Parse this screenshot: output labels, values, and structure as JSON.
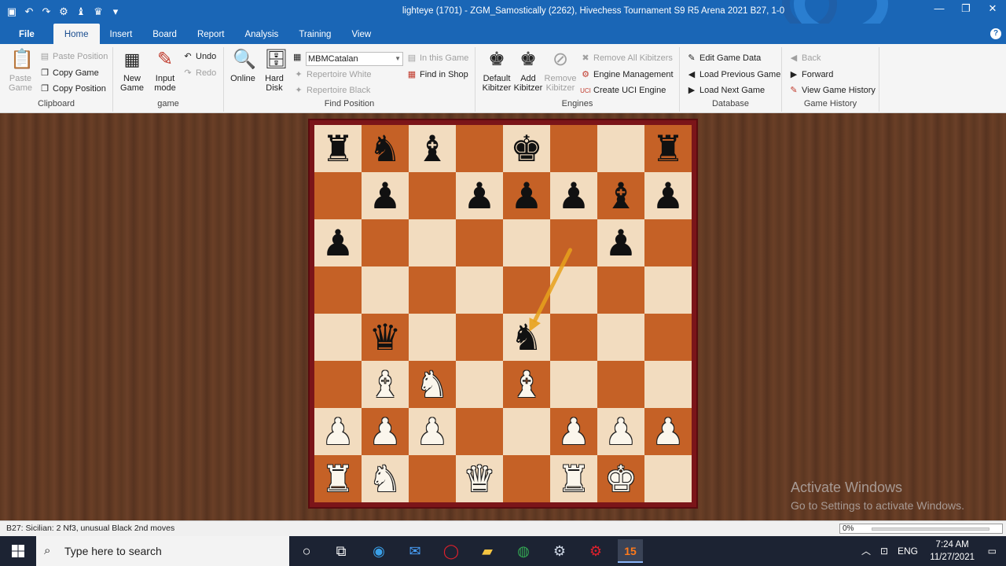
{
  "window": {
    "title": "lighteye (1701) - ZGM_Samostically (2262), Hivechess Tournament S9 R5 Arena 2021  B27, 1-0"
  },
  "tabs": [
    "File",
    "Home",
    "Insert",
    "Board",
    "Report",
    "Analysis",
    "Training",
    "View"
  ],
  "active_tab": "Home",
  "ribbon": {
    "clipboard": {
      "label": "Clipboard",
      "paste_game": "Paste Game",
      "paste_position": "Paste Position",
      "copy_game": "Copy Game",
      "copy_position": "Copy Position"
    },
    "game": {
      "label": "game",
      "new_game": "New Game",
      "input_mode": "Input mode",
      "undo": "Undo",
      "redo": "Redo"
    },
    "find_position": {
      "label": "Find Position",
      "online": "Online",
      "hard_disk": "Hard Disk",
      "database_value": "MBMCatalan",
      "in_this_game": "In this Game",
      "find_in_shop": "Find in Shop",
      "repertoire_white": "Repertoire White",
      "repertoire_black": "Repertoire Black"
    },
    "engines": {
      "label": "Engines",
      "default_kibitzer": "Default Kibitzer",
      "add_kibitzer": "Add Kibitzer",
      "remove_kibitzer": "Remove Kibitzer",
      "remove_all_kibitzers": "Remove All Kibitzers",
      "engine_management": "Engine Management",
      "create_uci_engine": "Create UCI Engine"
    },
    "database": {
      "label": "Database",
      "edit_game_data": "Edit Game Data",
      "load_previous_game": "Load Previous Game",
      "load_next_game": "Load Next Game"
    },
    "game_history": {
      "label": "Game History",
      "back": "Back",
      "forward": "Forward",
      "view_game_history": "View Game History"
    }
  },
  "board": {
    "orientation": "white-bottom",
    "ranks": [
      [
        "r",
        "n",
        "b",
        "",
        "k",
        "",
        "",
        "r"
      ],
      [
        "",
        "p",
        "",
        "p",
        "p",
        "p",
        "b",
        "p"
      ],
      [
        "p",
        "",
        "",
        "",
        "",
        "",
        "p",
        ""
      ],
      [
        "",
        "",
        "",
        "",
        "",
        "",
        "",
        ""
      ],
      [
        "",
        "q",
        "",
        "",
        "n",
        "",
        "",
        ""
      ],
      [
        "",
        "B",
        "N",
        "",
        "B",
        "",
        "",
        ""
      ],
      [
        "P",
        "P",
        "P",
        "",
        "",
        "P",
        "P",
        "P"
      ],
      [
        "R",
        "N",
        "",
        "Q",
        "",
        "R",
        "K",
        ""
      ]
    ],
    "last_move_arrow": {
      "from": "f6",
      "to": "e4",
      "color": "#e8a21c"
    }
  },
  "watermark": {
    "line1": "Activate Windows",
    "line2": "Go to Settings to activate Windows."
  },
  "statusbar": {
    "text": "B27: Sicilian: 2 Nf3, unusual Black 2nd moves",
    "progress": "0%"
  },
  "taskbar": {
    "search_placeholder": "Type here to search",
    "language": "ENG",
    "time": "7:24 AM",
    "date": "11/27/2021"
  }
}
